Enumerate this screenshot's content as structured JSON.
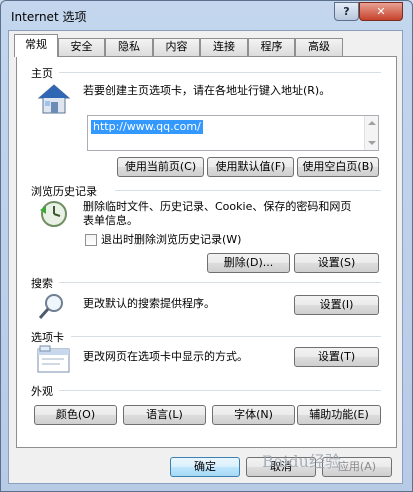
{
  "window": {
    "title": "Internet 选项",
    "help_glyph": "?",
    "close_glyph": "✕"
  },
  "tabs": [
    {
      "label": "常规",
      "active": true
    },
    {
      "label": "安全"
    },
    {
      "label": "隐私"
    },
    {
      "label": "内容"
    },
    {
      "label": "连接"
    },
    {
      "label": "程序"
    },
    {
      "label": "高级"
    }
  ],
  "home": {
    "group_label": "主页",
    "description": "若要创建主页选项卡，请在各地址行键入地址(R)。",
    "url": "http://www.qq.com/",
    "btn_current": "使用当前页(C)",
    "btn_default": "使用默认值(F)",
    "btn_blank": "使用空白页(B)"
  },
  "history": {
    "group_label": "浏览历史记录",
    "description_line1": "删除临时文件、历史记录、Cookie、保存的密码和网页",
    "description_line2": "表单信息。",
    "checkbox_label": "退出时删除浏览历史记录(W)",
    "btn_delete": "删除(D)...",
    "btn_settings": "设置(S)"
  },
  "search": {
    "group_label": "搜索",
    "description": "更改默认的搜索提供程序。",
    "btn_settings": "设置(I)"
  },
  "tabbed": {
    "group_label": "选项卡",
    "description": "更改网页在选项卡中显示的方式。",
    "btn_settings": "设置(T)"
  },
  "appearance": {
    "group_label": "外观",
    "btn_colors": "颜色(O)",
    "btn_languages": "语言(L)",
    "btn_fonts": "字体(N)",
    "btn_accessibility": "辅助功能(E)"
  },
  "footer": {
    "btn_ok": "确定",
    "btn_cancel": "取消",
    "btn_apply": "应用(A)"
  },
  "watermark": "Baidu经验",
  "colors": {
    "accent": "#3399ff",
    "panel": "#ffffff",
    "frame": "#b7cbe7"
  }
}
